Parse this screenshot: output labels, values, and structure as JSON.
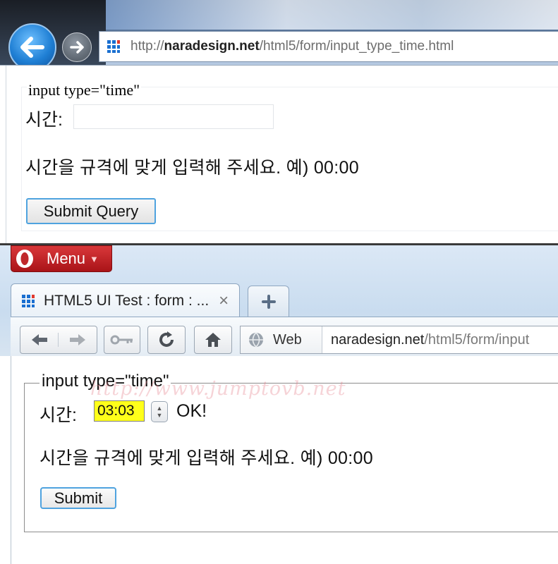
{
  "ie": {
    "address_url_prefix": "http://",
    "address_url_domain": "naradesign.net",
    "address_url_path": "/html5/form/input_type_time.html",
    "legend": "input type=\"time\"",
    "time_label": "시간:",
    "time_value": "",
    "hint": "시간을 규격에 맞게 입력해 주세요. 예) 00:00",
    "submit_label": "Submit Query"
  },
  "opera": {
    "menu_label": "Menu",
    "tab_title": "HTML5 UI Test : form : ...",
    "address_web_label": "Web",
    "address_url_domain": "naradesign.net",
    "address_url_path": "/html5/form/input",
    "legend": "input type=\"time\"",
    "watermark": "http://www.jumptovb.net",
    "time_label": "시간:",
    "time_value": "03:03",
    "validation_text": "OK!",
    "hint": "시간을 규격에 맞게 입력해 주세요. 예) 00:00",
    "submit_label": "Submit"
  },
  "colors": {
    "opera_menu_red": "#c0282b",
    "time_input_highlight": "#ffff1a",
    "button_focus_border": "#4fa3df"
  }
}
